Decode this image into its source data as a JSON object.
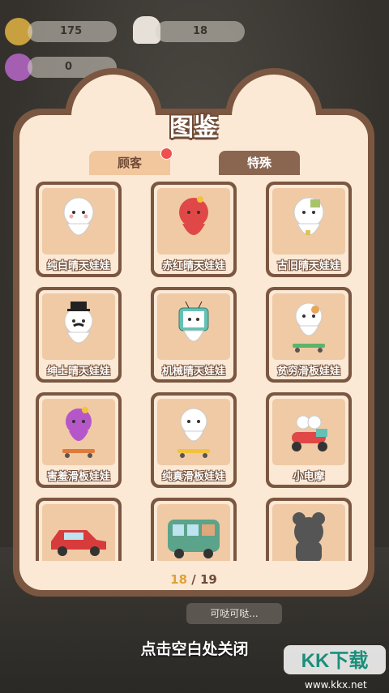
{
  "hud": {
    "coins": "175",
    "chefs": "18",
    "paws": "0"
  },
  "panel": {
    "title": "图鉴",
    "tabs": [
      {
        "label": "顾客",
        "has_badge": true
      },
      {
        "label": "特殊",
        "active": true
      }
    ],
    "items": [
      {
        "label": "纯白晴天娃娃",
        "icon": "white-doll-icon"
      },
      {
        "label": "赤红晴天娃娃",
        "icon": "red-doll-icon"
      },
      {
        "label": "古旧晴天娃娃",
        "icon": "patched-doll-icon"
      },
      {
        "label": "绅士晴天娃娃",
        "icon": "gentleman-doll-icon"
      },
      {
        "label": "机械晴天娃娃",
        "icon": "tv-robot-doll-icon"
      },
      {
        "label": "贫穷滑板娃娃",
        "icon": "skateboard-doll-icon"
      },
      {
        "label": "害羞滑板娃娃",
        "icon": "purple-skateboard-doll-icon"
      },
      {
        "label": "纯真滑板娃娃",
        "icon": "white-skateboard-doll-icon"
      },
      {
        "label": "小电摩",
        "icon": "scooter-icon"
      },
      {
        "label": "",
        "icon": "red-car-icon"
      },
      {
        "label": "",
        "icon": "green-van-icon"
      },
      {
        "label": "",
        "icon": "locked-silhouette-icon"
      }
    ],
    "counter": {
      "current": "18",
      "separator": " / ",
      "total": "19"
    }
  },
  "bubble": "可哒可哒...",
  "close_hint": "点击空白处关闭",
  "watermark": {
    "logo": "KK下载",
    "url": "www.kkx.net"
  },
  "colors": {
    "frame": "#7b5741",
    "panel": "#fbe9d6",
    "card_bg": "#efcaa5",
    "counter": "#e0a13b"
  }
}
